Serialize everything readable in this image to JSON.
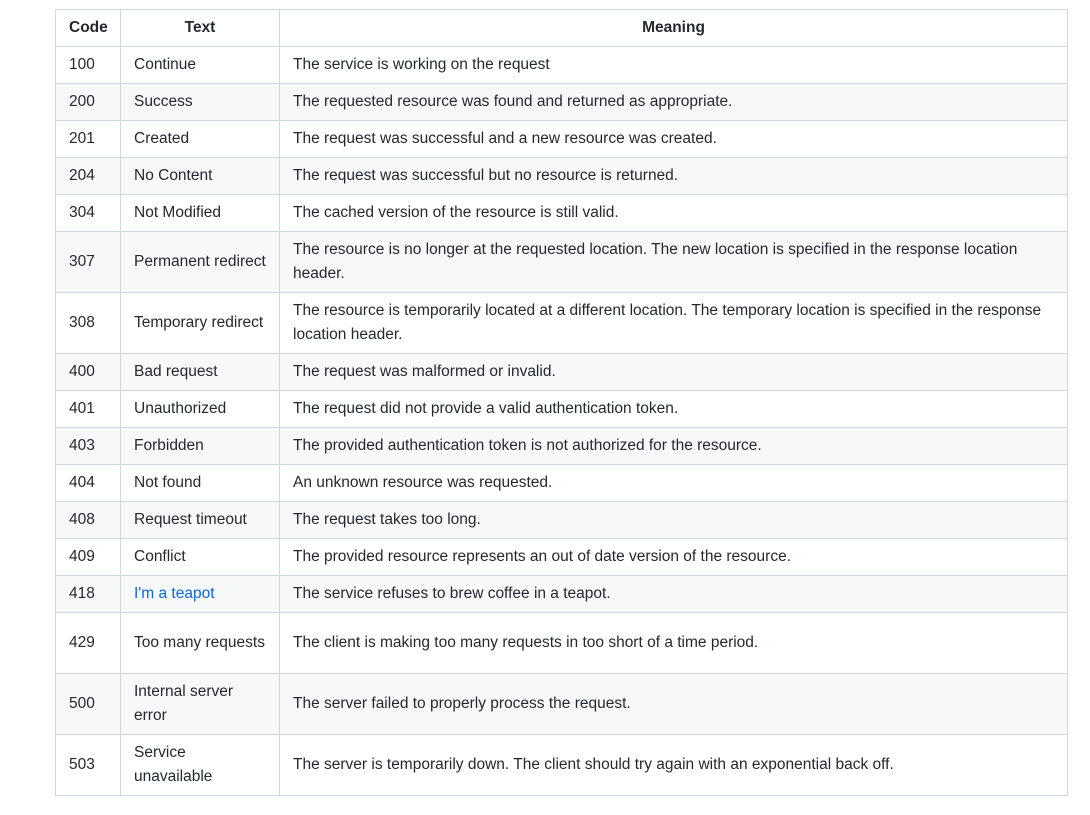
{
  "headers": {
    "code": "Code",
    "text": "Text",
    "meaning": "Meaning"
  },
  "rows": [
    {
      "code": "100",
      "text": "Continue",
      "meaning": "The service is working on the request"
    },
    {
      "code": "200",
      "text": "Success",
      "meaning": "The requested resource was found and returned as appropriate."
    },
    {
      "code": "201",
      "text": "Created",
      "meaning": "The request was successful and a new resource was created."
    },
    {
      "code": "204",
      "text": "No Content",
      "meaning": "The request was successful but no resource is returned."
    },
    {
      "code": "304",
      "text": "Not Modified",
      "meaning": "The cached version of the resource is still valid."
    },
    {
      "code": "307",
      "text": "Permanent redirect",
      "meaning": "The resource is no longer at the requested location. The new location is specified in the response location header."
    },
    {
      "code": "308",
      "text": "Temporary redirect",
      "meaning": "The resource is temporarily located at a different location. The temporary location is specified in the response location header."
    },
    {
      "code": "400",
      "text": "Bad request",
      "meaning": "The request was malformed or invalid."
    },
    {
      "code": "401",
      "text": "Unauthorized",
      "meaning": "The request did not provide a valid authentication token."
    },
    {
      "code": "403",
      "text": "Forbidden",
      "meaning": "The provided authentication token is not authorized for the resource."
    },
    {
      "code": "404",
      "text": "Not found",
      "meaning": "An unknown resource was requested."
    },
    {
      "code": "408",
      "text": "Request timeout",
      "meaning": "The request takes too long."
    },
    {
      "code": "409",
      "text": "Conflict",
      "meaning": "The provided resource represents an out of date version of the resource."
    },
    {
      "code": "418",
      "text": "I'm a teapot",
      "meaning": "The service refuses to brew coffee in a teapot."
    },
    {
      "code": "429",
      "text": "Too many requests",
      "meaning": "The client is making too many requests in too short of a time period."
    },
    {
      "code": "500",
      "text": "Internal server error",
      "meaning": "The server failed to properly process the request."
    },
    {
      "code": "503",
      "text": "Service unavailable",
      "meaning": "The server is temporarily down. The client should try again with an exponential back off."
    }
  ],
  "colors": {
    "link": "#0969da",
    "border": "#d0d7de",
    "stripe": "#f6f8fa",
    "text": "#24292f"
  }
}
